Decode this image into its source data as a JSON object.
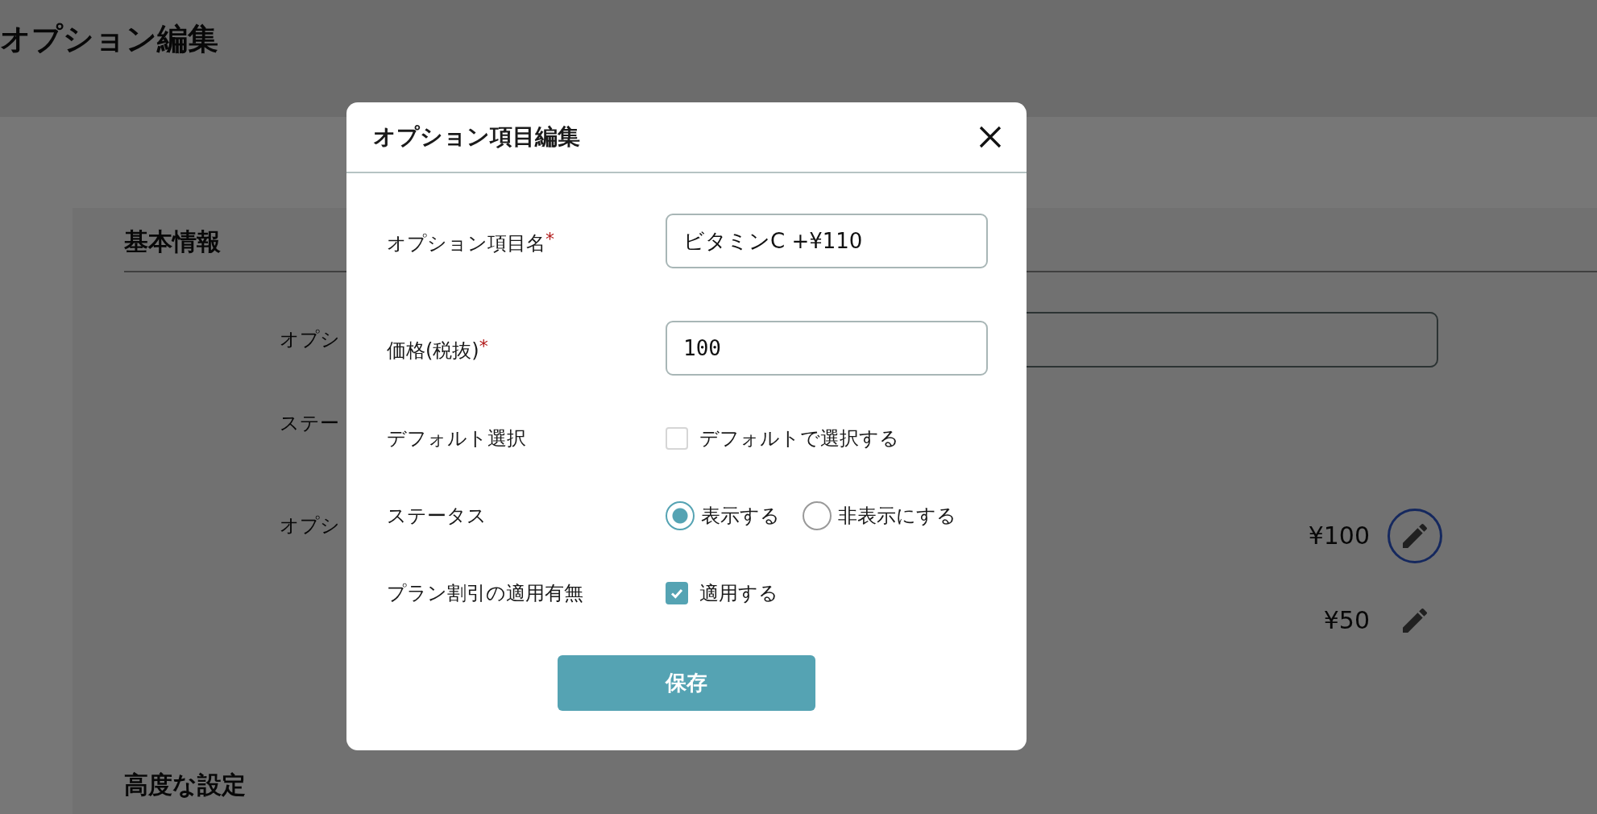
{
  "page": {
    "title": "オプション編集",
    "section_heading": "基本情報",
    "rows": [
      {
        "kind": "field",
        "label": "オプシ"
      },
      {
        "kind": "text",
        "label": "ステー"
      },
      {
        "kind": "options",
        "label": "オプシ",
        "options": [
          {
            "price": "¥100",
            "focused": true
          },
          {
            "price": "¥50",
            "focused": false
          }
        ]
      }
    ],
    "next_section_heading": "高度な設定"
  },
  "dialog": {
    "title": "オプション項目編集",
    "fields": [
      {
        "kind": "text",
        "label": "オプション項目名",
        "required_mark": "*",
        "value": "ビタミンC +¥110"
      },
      {
        "kind": "number",
        "label": "価格(税抜)",
        "required_mark": "*",
        "value": "100"
      },
      {
        "kind": "checkbox",
        "label": "デフォルト選択",
        "option_label": "デフォルトで選択する",
        "checked": false
      },
      {
        "kind": "radio",
        "label": "ステータス",
        "options": [
          {
            "label": "表示する",
            "selected": true
          },
          {
            "label": "非表示にする",
            "selected": false
          }
        ]
      },
      {
        "kind": "checkbox",
        "label": "プラン割引の適用有無",
        "option_label": "適用する",
        "checked": true
      }
    ],
    "save_button": "保存"
  }
}
